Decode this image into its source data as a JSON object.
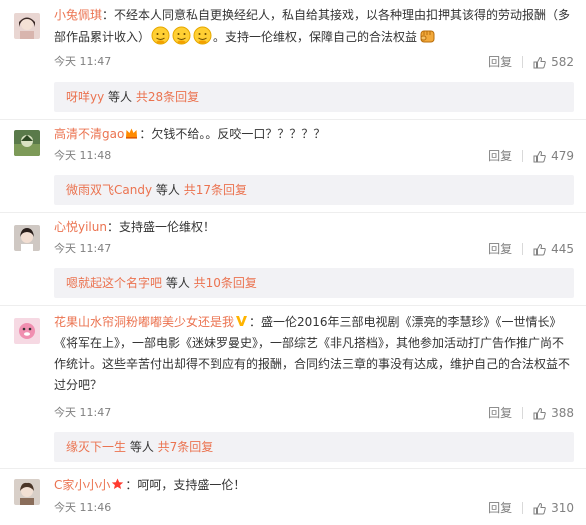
{
  "comments": [
    {
      "user": "小兔佩琪",
      "text_part1": "：不经本人同意私自更换经纪人，私自给其接戏，以各种理由扣押其该得的劳动报酬（多部作品累计收入）",
      "text_part2": "。支持一伦维权，保障自己的合法权益",
      "time": "今天 11:47",
      "reply_label": "回复",
      "likes": "582",
      "sub": {
        "who": "呀咩yy",
        "mid": " 等人 ",
        "count": "共28条回复"
      }
    },
    {
      "user": "高清不清gao",
      "text": "：欠钱不给。。反咬一口？？？？？",
      "time": "今天 11:48",
      "reply_label": "回复",
      "likes": "479",
      "sub": {
        "who": "微雨双飞Candy",
        "mid": " 等人 ",
        "count": "共17条回复"
      }
    },
    {
      "user": "心悦yilun",
      "text": "：支持盛一伦维权！",
      "time": "今天 11:47",
      "reply_label": "回复",
      "likes": "445",
      "sub": {
        "who": "嗯就起这个名字吧",
        "mid": " 等人 ",
        "count": "共10条回复"
      }
    },
    {
      "user": "花果山水帘洞粉嘟嘟美少女还是我",
      "text": "：盛一伦2016年三部电视剧《漂亮的李慧珍》《一世情长》《将军在上》，一部电影《迷妹罗曼史》，一部综艺《非凡搭档》，其他参加活动打广告作推广尚不作统计。这些辛苦付出却得不到应有的报酬，合同约法三章的事没有达成，维护自己的合法权益不过分吧？",
      "time": "今天 11:47",
      "reply_label": "回复",
      "likes": "388",
      "sub": {
        "who": "缘灭下一生",
        "mid": " 等人 ",
        "count": "共7条回复"
      }
    },
    {
      "user": "C家小小小",
      "text": "：呵呵，支持盛一伦！",
      "time": "今天 11:46",
      "reply_label": "回复",
      "likes": "310"
    }
  ],
  "colors": {
    "username": "#eb7350",
    "meta": "#808080",
    "subbox_bg": "#f2f2f5"
  }
}
